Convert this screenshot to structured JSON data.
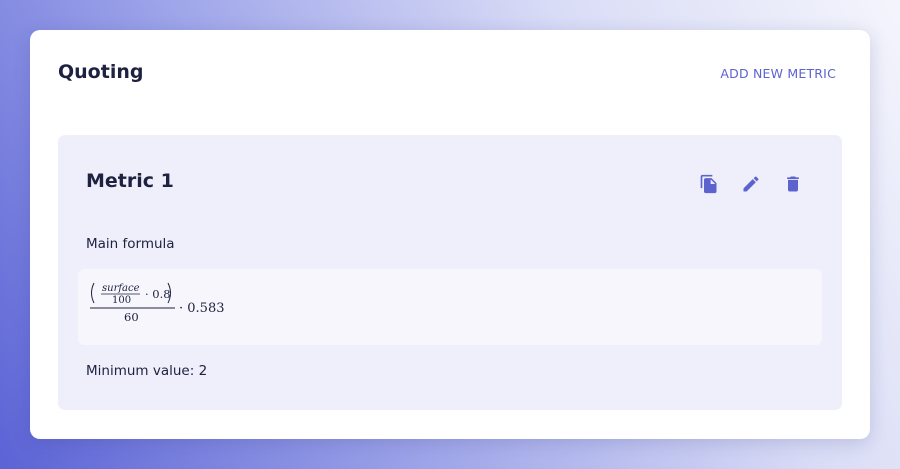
{
  "card": {
    "title": "Quoting",
    "add_button_label": "ADD NEW METRIC"
  },
  "metric": {
    "name": "Metric 1",
    "actions": [
      {
        "icon": "copy-icon"
      },
      {
        "icon": "edit-icon"
      },
      {
        "icon": "delete-icon"
      }
    ],
    "formula_label": "Main formula",
    "formula": {
      "variable": "surface",
      "inner_denominator": "100",
      "inner_factor": "· 0.8",
      "outer_denominator": "60",
      "outer_factor": "· 0.583"
    },
    "minimum_value_text": "Minimum value: 2"
  },
  "colors": {
    "accent": "#5c63cf",
    "text": "#1e2140",
    "panel": "#eeeffb",
    "formula_bg": "#f6f6fc"
  }
}
